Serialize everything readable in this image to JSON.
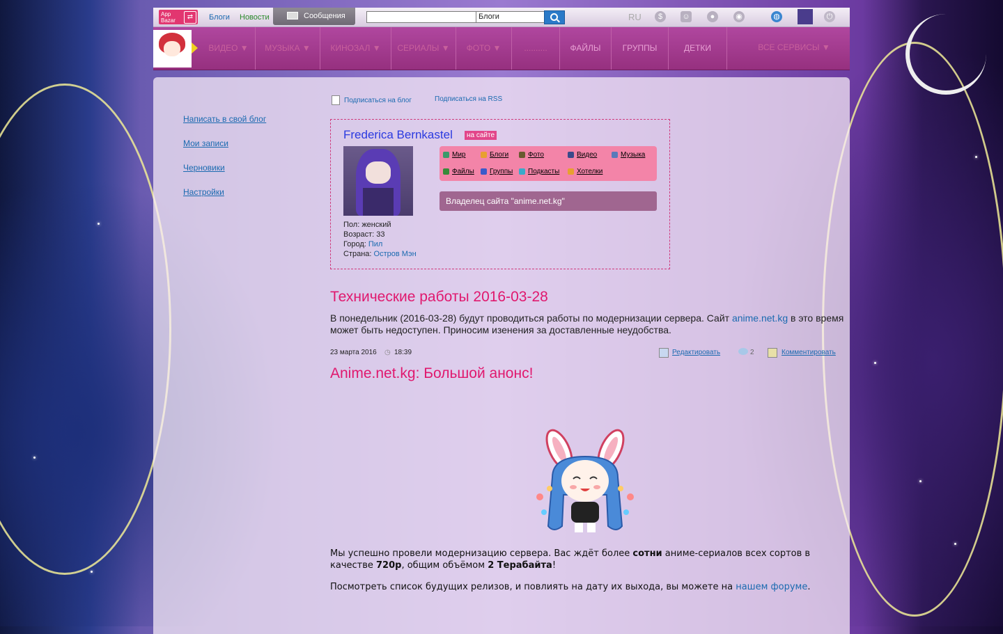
{
  "topbar": {
    "logo": "App Bazar",
    "blogs": "Блоги",
    "news": "Новости",
    "messages": "Сообщения",
    "search_value": "",
    "search_scope": "Блоги",
    "lang": "RU"
  },
  "nav": {
    "items": [
      "ВИДЕО ▼",
      "МУЗЫКА ▼",
      "КИНОЗАЛ ▼",
      "СЕРИАЛЫ ▼",
      "ФОТО ▼",
      "..........",
      "ФАЙЛЫ",
      "ГРУППЫ",
      "ДЕТКИ",
      "ВСЕ СЕРВИСЫ ▼"
    ]
  },
  "sidebar": {
    "items": [
      "Написать в свой блог",
      "Мои записи",
      "Черновики",
      "Настройки"
    ]
  },
  "subscribe": {
    "blog": "Подписаться на блог",
    "rss": "Подписаться на RSS"
  },
  "profile": {
    "name": "Frederica Bernkastel",
    "status": "на сайте",
    "gender_label": "Пол:",
    "gender": "женский",
    "age_label": "Возраст:",
    "age": "33",
    "city_label": "Город:",
    "city": "Пил",
    "country_label": "Страна:",
    "country": "Остров Мэн",
    "links": [
      "Мир",
      "Блоги",
      "Фото",
      "Видео",
      "Музыка",
      "Файлы",
      "Группы",
      "Подкасты",
      "Хотелки"
    ],
    "owner_text": "Владелец сайта \"anime.net.kg\""
  },
  "post1": {
    "title": "Технические работы 2016-03-28",
    "text_before": "В понедельник (2016-03-28) будут проводиться работы по модернизации сервера. Сайт ",
    "link": "anime.net.kg",
    "text_after": " в это время может быть недоступен. Приносим изенения за доставленные неудобства.",
    "date": "23 марта 2016",
    "time": "18:39",
    "edit": "Редактировать",
    "comments_count": "2",
    "comment": "Комментировать"
  },
  "post2": {
    "title": "Anime.net.kg: Большой анонс!",
    "p1_a": "Мы успешно провели модернизацию сервера. Вас ждёт более ",
    "p1_b": "сотни",
    "p1_c": " аниме-сериалов всех сортов в качестве ",
    "p1_d": "720p",
    "p1_e": ", общим объёмом ",
    "p1_f": "2 Терабайта",
    "p1_g": "!",
    "p2_a": "Посмотреть список будущих релизов, и повлиять на дату их выхода, вы можете на ",
    "p2_link": "нашем форуме",
    "p2_b": "."
  },
  "colors": {
    "accent": "#e0186e",
    "nav": "#a33b8f",
    "link": "#1a6ab0"
  }
}
